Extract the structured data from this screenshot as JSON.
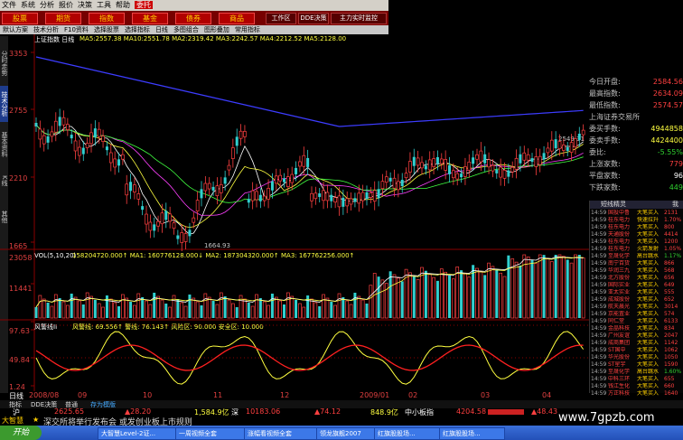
{
  "menu": {
    "items": [
      "文件",
      "系统",
      "分析",
      "报价",
      "决策",
      "工具",
      "帮助",
      "委托"
    ],
    "active": "委托"
  },
  "modules": {
    "buttons": [
      "股票",
      "期货",
      "指数",
      "基金",
      "债券",
      "商品",
      "工作区",
      "DDE决策",
      "主力实时监控"
    ]
  },
  "toolbar": {
    "items": [
      "默认方案",
      "技术分析",
      "F10资料",
      "选择股票",
      "选择指标",
      "日线",
      "多图组合",
      "图形叠加",
      "常用指标"
    ]
  },
  "left_tabs": [
    "分时走势",
    "技术分析",
    "基本资料",
    "K线",
    "其他"
  ],
  "price_axis": [
    "3353",
    "2755",
    "2210",
    "1665"
  ],
  "price_header": {
    "title": "上证指数 日线",
    "ma": "MA5:2557.38  MA10:2551.78  MA2:2319.42  MA3:2242.57  MA4:2212.52  MA5:2128.00"
  },
  "price_annotations": {
    "high": "2549.31",
    "low": "1664.93"
  },
  "vol_axis": [
    "23058",
    "11441"
  ],
  "vol_header": {
    "label": "VOL(5,10,20)",
    "vals": "158204720.000↑ MA1: 160776128.000↓ MA2: 187304320.000↑ MA3: 167762256.000↑"
  },
  "ind_axis": [
    "97.63",
    "49.84",
    "1.24"
  ],
  "ind_header": {
    "label": "风警线II",
    "vals": "风警线: 69.556↑  警线: 76.143↑  风险区: 90.000  安全区: 10.000"
  },
  "date_bar": {
    "mode": "日线",
    "dates": [
      "2008/08",
      "09",
      "10",
      "11",
      "12",
      "2009/01",
      "02",
      "03",
      "04"
    ]
  },
  "info_panel": {
    "rows": [
      {
        "label": "今日开盘:",
        "value": "2584.56",
        "color": "#ff4040"
      },
      {
        "label": "最高指数:",
        "value": "2634.09",
        "color": "#ff4040"
      },
      {
        "label": "最低指数:",
        "value": "2574.57",
        "color": "#ff4040"
      },
      {
        "label": "上海证券交易所",
        "value": "",
        "color": "#c0c0c0"
      },
      {
        "label": "委买手数:",
        "value": "4944858",
        "color": "#ffff40"
      },
      {
        "label": "委卖手数:",
        "value": "4424400",
        "color": "#ffff40"
      },
      {
        "label": "委比:",
        "value": "-5.55%",
        "color": "#30d030"
      },
      {
        "label": "上涨家数:",
        "value": "779",
        "color": "#ff4040"
      },
      {
        "label": "平盘家数:",
        "value": "96",
        "color": "#ffffff"
      },
      {
        "label": "下跌家数:",
        "value": "449",
        "color": "#30d030"
      }
    ]
  },
  "stock_list": {
    "title": "短线精灵",
    "tabs": [
      "短线精灵",
      "我"
    ],
    "rows": [
      {
        "t": "14:59",
        "n": "国投中鲁",
        "s": "大笔买入",
        "v": "2131",
        "c": "#ff4040"
      },
      {
        "t": "14:59",
        "n": "桂东电力",
        "s": "快速拉升",
        "v": "1.70%",
        "c": "#ff4040"
      },
      {
        "t": "14:59",
        "n": "桂东电力",
        "s": "大笔买入",
        "v": "800",
        "c": "#ff4040"
      },
      {
        "t": "14:59",
        "n": "天通股份",
        "s": "大笔买入",
        "v": "4414",
        "c": "#ff4040"
      },
      {
        "t": "14:59",
        "n": "桂东电力",
        "s": "大笔买入",
        "v": "1200",
        "c": "#ff4040"
      },
      {
        "t": "14:59",
        "n": "桂东电力",
        "s": "火箭发射",
        "v": "1.05%",
        "c": "#ff4040"
      },
      {
        "t": "14:59",
        "n": "至晟化学",
        "s": "高台跳水",
        "v": "1.17%",
        "c": "#30d030"
      },
      {
        "t": "14:59",
        "n": "南宁百货",
        "s": "大笔买入",
        "v": "866",
        "c": "#ff4040"
      },
      {
        "t": "14:59",
        "n": "华润三九",
        "s": "大笔买入",
        "v": "568",
        "c": "#ff4040"
      },
      {
        "t": "14:59",
        "n": "北方股份",
        "s": "大笔买入",
        "v": "656",
        "c": "#ff4040"
      },
      {
        "t": "14:59",
        "n": "国际实业",
        "s": "大笔买入",
        "v": "649",
        "c": "#ff4040"
      },
      {
        "t": "14:59",
        "n": "亚太实业",
        "s": "大笔买入",
        "v": "555",
        "c": "#ff4040"
      },
      {
        "t": "14:59",
        "n": "成城股份",
        "s": "大笔买入",
        "v": "652",
        "c": "#ff4040"
      },
      {
        "t": "14:59",
        "n": "航天晨光",
        "s": "大笔买入",
        "v": "3014",
        "c": "#ff4040"
      },
      {
        "t": "14:59",
        "n": "京能置业",
        "s": "大笔买入",
        "v": "574",
        "c": "#ff4040"
      },
      {
        "t": "14:59",
        "n": "同仁堂",
        "s": "大笔买入",
        "v": "6133",
        "c": "#ff4040"
      },
      {
        "t": "14:59",
        "n": "金晶科技",
        "s": "大笔买入",
        "v": "834",
        "c": "#ff4040"
      },
      {
        "t": "14:59",
        "n": "广州友谊",
        "s": "大笔买入",
        "v": "2047",
        "c": "#ff4040"
      },
      {
        "t": "14:59",
        "n": "成商集团",
        "s": "大笔买入",
        "v": "1142",
        "c": "#ff4040"
      },
      {
        "t": "14:59",
        "n": "ST国中",
        "s": "大笔买入",
        "v": "1062",
        "c": "#ff4040"
      },
      {
        "t": "14:59",
        "n": "华光股份",
        "s": "大笔买入",
        "v": "1050",
        "c": "#ff4040"
      },
      {
        "t": "14:59",
        "n": "ST星宇",
        "s": "大笔买入",
        "v": "1590",
        "c": "#ff4040"
      },
      {
        "t": "14:59",
        "n": "至晟化学",
        "s": "高台跳水",
        "v": "1.60%",
        "c": "#30d030"
      },
      {
        "t": "14:59",
        "n": "中科三环",
        "s": "大笔买入",
        "v": "655",
        "c": "#ff4040"
      },
      {
        "t": "14:59",
        "n": "钱江生化",
        "s": "大笔买入",
        "v": "660",
        "c": "#ff4040"
      },
      {
        "t": "14:59",
        "n": "方正科技",
        "s": "大笔买入",
        "v": "1640",
        "c": "#ff4040"
      }
    ]
  },
  "bottom_tabs": [
    "指标",
    "DDE决策",
    "普通",
    "存为模版"
  ],
  "ticker": {
    "a_name": "沪",
    "a_val": "2625.65",
    "a_chg": "▲28.20",
    "a_amt": "1,584.9亿",
    "b_name": "深",
    "b_val": "10183.06",
    "b_chg": "▲74.12",
    "b_amt": "848.9亿",
    "c_name": "中小板指",
    "c_val": "4204.58",
    "c_chg": "▲48.43"
  },
  "news": {
    "label": "大智慧",
    "text": "深交所将举行发布会 或发创业板上市规则"
  },
  "taskbar": {
    "start": "开始",
    "tasks": [
      "大智慧Level-2证...",
      "一周视频全套",
      "涨幅看视频全套",
      "领龙旗舰2007",
      "红旗股股场...",
      "红旗股股场..."
    ]
  },
  "watermark": "www.7gpzb.com",
  "colors": {
    "up": "#ff4040",
    "down": "#30d0d0",
    "ma1": "#ffffff",
    "ma2": "#ffff40",
    "ma3": "#ff40ff",
    "ma4": "#40ff40",
    "ma5": "#4040ff"
  }
}
